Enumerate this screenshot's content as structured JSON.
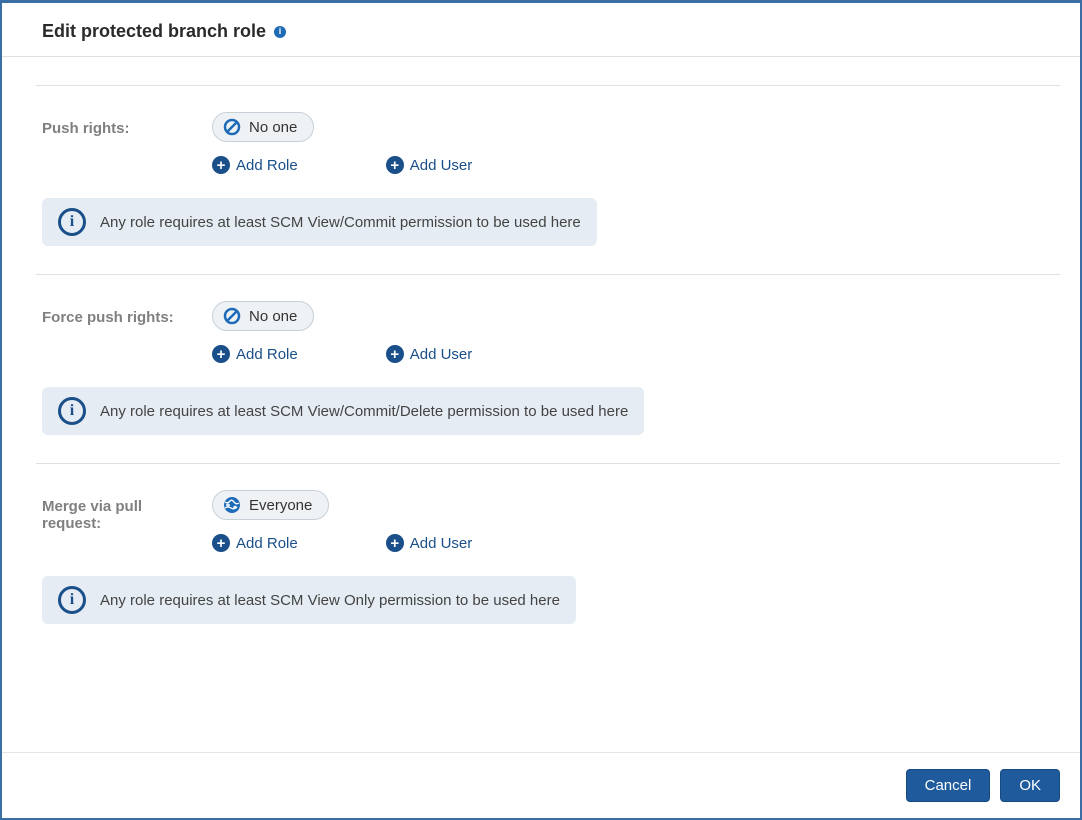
{
  "dialog": {
    "title": "Edit protected branch role"
  },
  "actions": {
    "add_role": "Add Role",
    "add_user": "Add User"
  },
  "sections": {
    "push": {
      "label": "Push rights:",
      "selected": "No one",
      "selected_icon": "no-one",
      "info": "Any role requires at least SCM View/Commit permission to be used here"
    },
    "force_push": {
      "label": "Force push rights:",
      "selected": "No one",
      "selected_icon": "no-one",
      "info": "Any role requires at least SCM View/Commit/Delete permission to be used here"
    },
    "merge": {
      "label": "Merge via pull request:",
      "selected": "Everyone",
      "selected_icon": "everyone",
      "info": "Any role requires at least SCM View Only permission to be used here"
    }
  },
  "footer": {
    "cancel": "Cancel",
    "ok": "OK"
  }
}
